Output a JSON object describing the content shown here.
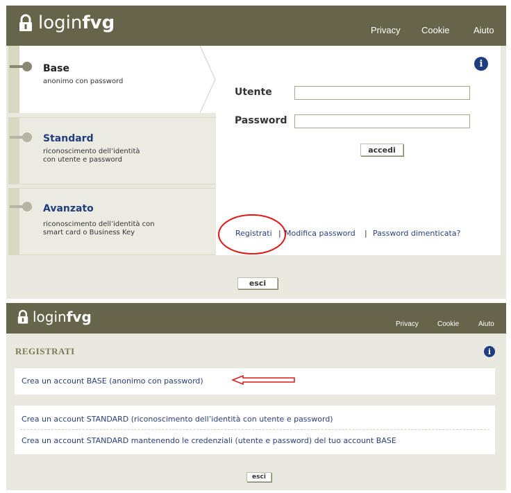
{
  "top": {
    "logo": {
      "prefix": "login",
      "bold": "fvg"
    },
    "nav": [
      "Privacy",
      "Cookie",
      "Aiuto"
    ],
    "tabs": [
      {
        "title": "Base",
        "desc_line1": "anonimo con password",
        "desc_line2": ""
      },
      {
        "title": "Standard",
        "desc_line1": "riconoscimento dell’identità",
        "desc_line2": "con utente e password"
      },
      {
        "title": "Avanzato",
        "desc_line1": "riconoscimento dell’identità con",
        "desc_line2": "smart card o Business Key"
      }
    ],
    "form": {
      "user_label": "Utente",
      "user_value": "",
      "password_label": "Password",
      "password_value": "",
      "submit_label": "accedi"
    },
    "links": {
      "register": "Registrati",
      "sep": "|",
      "change_password": "Modifica password",
      "forgot_password": "Password dimenticata?"
    },
    "exit_label": "esci"
  },
  "bottom": {
    "logo": {
      "prefix": "login",
      "bold": "fvg"
    },
    "nav": [
      "Privacy",
      "Cookie",
      "Aiuto"
    ],
    "section_title": "REGISTRATI",
    "options": [
      "Crea un account BASE (anonimo con password)",
      "Crea un account STANDARD (riconoscimento dell’identità con utente e password)",
      "Crea un account STANDARD mantenendo le credenziali (utente e password) del tuo account BASE"
    ],
    "exit_label": "esci"
  },
  "colors": {
    "header": "#66654a",
    "panel": "#e9e9e0",
    "tab_border": "#d8d8c3",
    "link": "#2a3f7a",
    "title_active": "#222222",
    "title_inactive": "#1f3d80",
    "section_title": "#7a7a52",
    "annotation": "#e01515"
  }
}
